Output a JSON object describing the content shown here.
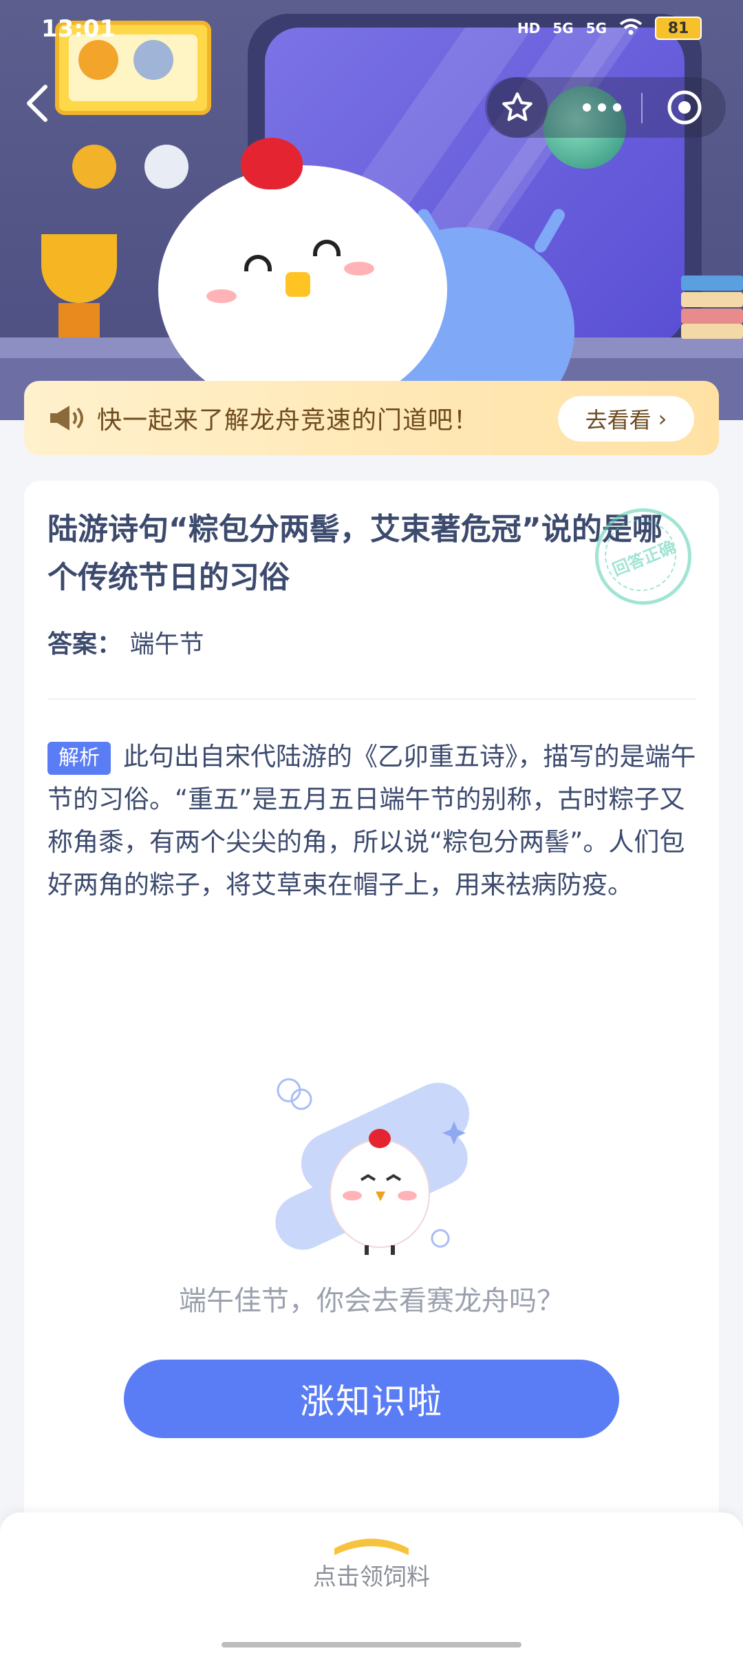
{
  "status_bar": {
    "time": "13:01",
    "network": "HD",
    "signal1": "5G",
    "signal2": "5G",
    "battery": "81"
  },
  "nav": {
    "back_icon": "chevron-left-icon",
    "favorite_icon": "star-icon",
    "more_icon": "more-dots-icon",
    "close_icon": "target-icon"
  },
  "banner": {
    "text": "快一起来了解龙舟竞速的门道吧！",
    "button_label": "去看看",
    "button_arrow": "›"
  },
  "card": {
    "question": "陆游诗句“粽包分两髻，艾束著危冠”说的是哪个传统节日的习俗",
    "stamp_text": "回答正确",
    "answer_label": "答案：",
    "answer_value": "端午节",
    "analysis_tag": "解析",
    "analysis_text": "此句出自宋代陆游的《乙卯重五诗》，描写的是端午节的习俗。“重五”是五月五日端午节的别称，古时粽子又称角黍，有两个尖尖的角，所以说“粽包分两髻”。人们包好两角的粽子，将艾草束在帽子上，用来祛病防疫。",
    "promo_text": "端午佳节，你会去看赛龙舟吗？",
    "learn_button": "涨知识啦"
  },
  "bottom": {
    "claim_text": "点击领饲料"
  },
  "colors": {
    "accent": "#5a7df5",
    "banner_text": "#6d4b1f",
    "question_text": "#3c4a6e",
    "stamp": "#56cfb2"
  }
}
